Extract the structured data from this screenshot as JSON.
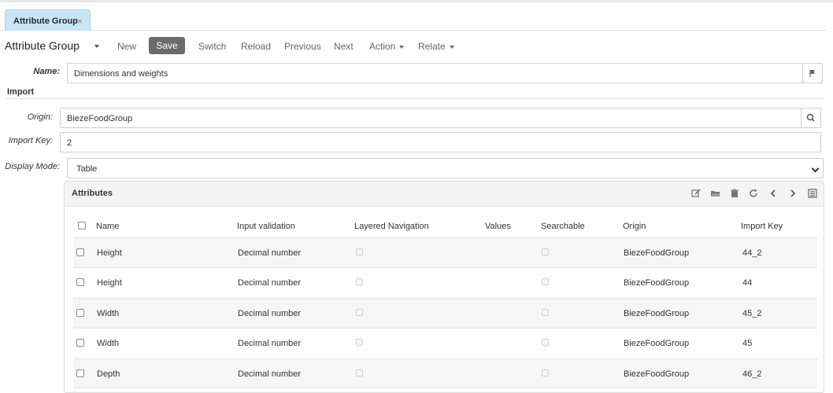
{
  "tab": {
    "label": "Attribute Group",
    "close": "×"
  },
  "toolbar": {
    "title": "Attribute Group",
    "new": "New",
    "save": "Save",
    "switch": "Switch",
    "reload": "Reload",
    "previous": "Previous",
    "next": "Next",
    "action": "Action",
    "relate": "Relate"
  },
  "form": {
    "name_label": "Name:",
    "name_value": "Dimensions and weights",
    "import_section": "Import",
    "origin_label": "Origin:",
    "origin_value": "BiezeFoodGroup",
    "import_key_label": "Import Key:",
    "import_key_value": "2",
    "display_mode_label": "Display Mode:",
    "display_mode_value": "Table"
  },
  "attributes": {
    "title": "Attributes",
    "columns": {
      "name": "Name",
      "input_validation": "Input validation",
      "layered_navigation": "Layered Navigation",
      "values": "Values",
      "searchable": "Searchable",
      "origin": "Origin",
      "import_key": "Import Key"
    },
    "rows": [
      {
        "name": "Height",
        "input_validation": "Decimal number",
        "origin": "BiezeFoodGroup",
        "import_key": "44_2"
      },
      {
        "name": "Height",
        "input_validation": "Decimal number",
        "origin": "BiezeFoodGroup",
        "import_key": "44"
      },
      {
        "name": "Width",
        "input_validation": "Decimal number",
        "origin": "BiezeFoodGroup",
        "import_key": "45_2"
      },
      {
        "name": "Width",
        "input_validation": "Decimal number",
        "origin": "BiezeFoodGroup",
        "import_key": "45"
      },
      {
        "name": "Depth",
        "input_validation": "Decimal number",
        "origin": "BiezeFoodGroup",
        "import_key": "46_2"
      }
    ]
  },
  "colors": {
    "tab_bg": "#c9e5f5",
    "save_bg": "#6b6b6b"
  }
}
